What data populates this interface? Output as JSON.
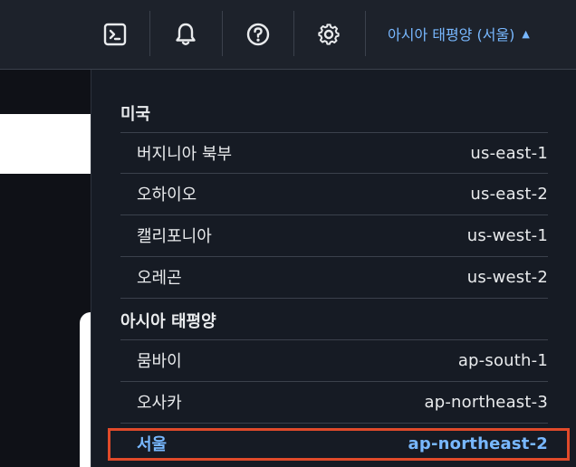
{
  "header": {
    "cloudshell_icon": "cloudshell-icon",
    "notifications_icon": "bell-icon",
    "help_icon": "help-icon",
    "settings_icon": "gear-icon",
    "region_label": "아시아 태평양 (서울)",
    "region_caret": "caret-up-icon"
  },
  "region_menu": {
    "groups": [
      {
        "title": "미국",
        "regions": [
          {
            "name": "버지니아 북부",
            "code": "us-east-1"
          },
          {
            "name": "오하이오",
            "code": "us-east-2"
          },
          {
            "name": "캘리포니아",
            "code": "us-west-1"
          },
          {
            "name": "오레곤",
            "code": "us-west-2"
          }
        ]
      },
      {
        "title": "아시아 태평양",
        "regions": [
          {
            "name": "뭄바이",
            "code": "ap-south-1"
          },
          {
            "name": "오사카",
            "code": "ap-northeast-3"
          },
          {
            "name": "서울",
            "code": "ap-northeast-2",
            "selected": true
          }
        ]
      }
    ]
  },
  "colors": {
    "accent": "#78b8ff",
    "highlight_border": "#e04a2a",
    "menu_bg": "#161b24",
    "header_bg": "#1d222b"
  }
}
